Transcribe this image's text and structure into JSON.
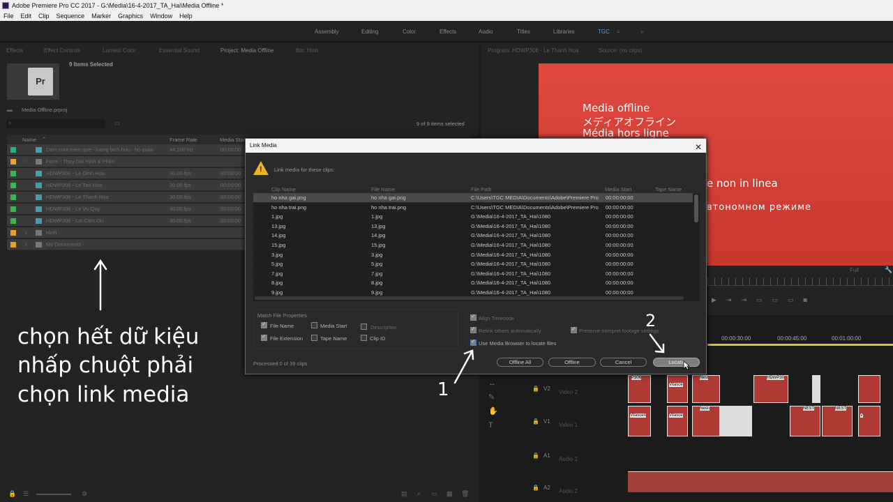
{
  "window": {
    "title": "Adobe Premiere Pro CC 2017 - G:\\Media\\16-4-2017_TA_Hai\\Media Offline *"
  },
  "menu": [
    "File",
    "Edit",
    "Clip",
    "Sequence",
    "Marker",
    "Graphics",
    "Window",
    "Help"
  ],
  "workspaces": [
    "Assembly",
    "Editing",
    "Color",
    "Effects",
    "Audio",
    "Titles",
    "Libraries",
    "TGC"
  ],
  "left_panel": {
    "tabs": [
      "Effects",
      "Effect Controls",
      "Lumetri Color",
      "Essential Sound",
      "Project: Media Offline",
      "Bin: Hinh"
    ],
    "selected_text": "9 Items Selected",
    "project_file": "Media Offline.prproj",
    "count_text": "9 of 9 items selected",
    "columns": [
      "Name",
      "Frame Rate",
      "Media Start"
    ],
    "rows": [
      {
        "name": "Dam cuoi mien que - luong bich huu - ho quan",
        "fr": "44,100 Hz",
        "ms": "00:00:00",
        "color": "#2cb08a"
      },
      {
        "name": "Form - Thay Doi Hinh & Phim",
        "fr": "",
        "ms": "",
        "color": "#e8a030"
      },
      {
        "name": "HDWP306 - Le Dinh Hoa",
        "fr": "30.00 fps",
        "ms": "00:00:00",
        "color": "#3fb34f"
      },
      {
        "name": "HDWP306 - Le Tan Hoa",
        "fr": "30.00 fps",
        "ms": "00:00:00",
        "color": "#3fb34f"
      },
      {
        "name": "HDWP306 - Le Thanh Hoa",
        "fr": "30.00 fps",
        "ms": "00:00:00",
        "color": "#3fb34f"
      },
      {
        "name": "HDWP306 - Le Vu Quy",
        "fr": "30.00 fps",
        "ms": "00:00:00",
        "color": "#3fb34f"
      },
      {
        "name": "HDWP306 - Loi Cam On",
        "fr": "30.00 fps",
        "ms": "00:00:00",
        "color": "#3fb34f"
      },
      {
        "name": "Hinh",
        "fr": "",
        "ms": "",
        "color": "#e8a030"
      },
      {
        "name": "My Documents",
        "fr": "",
        "ms": "",
        "color": "#e8a030"
      }
    ]
  },
  "annotation": {
    "line1": "chọn hết dữ kiệu",
    "line2": "nhấp chuột phải",
    "line3": "chọn link media",
    "n1": "1",
    "n2": "2"
  },
  "program": {
    "tabs": [
      "Program: HDWP306 - Le Thanh Hoa",
      "Source: (no clips)"
    ],
    "offline_lines": [
      "Media offline",
      "メディアオフライン",
      "Média hors ligne",
      "e non in linea",
      "втономном режиме"
    ],
    "zoom": "Full"
  },
  "timeline": {
    "times": [
      "00:00:30:00",
      "00:00:45:00",
      "00:01:00:00"
    ],
    "tracks": [
      "V2",
      "V1",
      "A1",
      "A2"
    ],
    "track_names": [
      "Video 2",
      "Video 1",
      "Audio 1",
      "Audio 2"
    ],
    "clip_labels": [
      "P306",
      "Vitasce",
      "Nest",
      "HDWP30",
      "Vitascen",
      "Vitasce",
      "Nest-",
      "NEST",
      "NEST",
      "V"
    ]
  },
  "dialog": {
    "title": "Link Media",
    "message": "Link media for these clips:",
    "columns": [
      "Clip Name",
      "File Name",
      "File Path",
      "Media Start",
      "Tape Name"
    ],
    "rows": [
      {
        "clip": "ho nha gai.png",
        "file": "ho nha gai.png",
        "path": "C:\\Users\\TGC MEDIA\\Documents\\Adobe\\Premiere Pro",
        "start": "00:00:00:00"
      },
      {
        "clip": "ho nha trai.png",
        "file": "ho nha trai.png",
        "path": "C:\\Users\\TGC MEDIA\\Documents\\Adobe\\Premiere Pro",
        "start": "00:00:00:00"
      },
      {
        "clip": "1.jpg",
        "file": "1.jpg",
        "path": "G:\\Media\\16-4-2017_TA_Hai\\1080",
        "start": "00:00:00:00"
      },
      {
        "clip": "13.jpg",
        "file": "13.jpg",
        "path": "G:\\Media\\16-4-2017_TA_Hai\\1080",
        "start": "00:00:00:00"
      },
      {
        "clip": "14.jpg",
        "file": "14.jpg",
        "path": "G:\\Media\\16-4-2017_TA_Hai\\1080",
        "start": "00:00:00:00"
      },
      {
        "clip": "15.jpg",
        "file": "15.jpg",
        "path": "G:\\Media\\16-4-2017_TA_Hai\\1080",
        "start": "00:00:00:00"
      },
      {
        "clip": "3.jpg",
        "file": "3.jpg",
        "path": "G:\\Media\\16-4-2017_TA_Hai\\1080",
        "start": "00:00:00:00"
      },
      {
        "clip": "5.jpg",
        "file": "5.jpg",
        "path": "G:\\Media\\16-4-2017_TA_Hai\\1080",
        "start": "00:00:00:00"
      },
      {
        "clip": "7.jpg",
        "file": "7.jpg",
        "path": "G:\\Media\\16-4-2017_TA_Hai\\1080",
        "start": "00:00:00:00"
      },
      {
        "clip": "8.jpg",
        "file": "8.jpg",
        "path": "G:\\Media\\16-4-2017_TA_Hai\\1080",
        "start": "00:00:00:00"
      },
      {
        "clip": "9.jpg",
        "file": "9.jpg",
        "path": "G:\\Media\\16-4-2017_TA_Hai\\1080",
        "start": "00:00:00:00"
      }
    ],
    "match_title": "Match File Properties",
    "opt_file_name": "File Name",
    "opt_media_start": "Media Start",
    "opt_description": "Description",
    "opt_file_ext": "File Extension",
    "opt_tape_name": "Tape Name",
    "opt_clip_id": "Clip ID",
    "align_tc": "Align Timecode",
    "relink_auto": "Relink others automatically",
    "preserve": "Preserve interpret footage settings",
    "use_browser": "Use Media Browser to locate files",
    "processed": "Processed 0 of 39 clips",
    "btn_offline_all": "Offline All",
    "btn_offline": "Offline",
    "btn_cancel": "Cancel",
    "btn_locate": "Locate"
  }
}
